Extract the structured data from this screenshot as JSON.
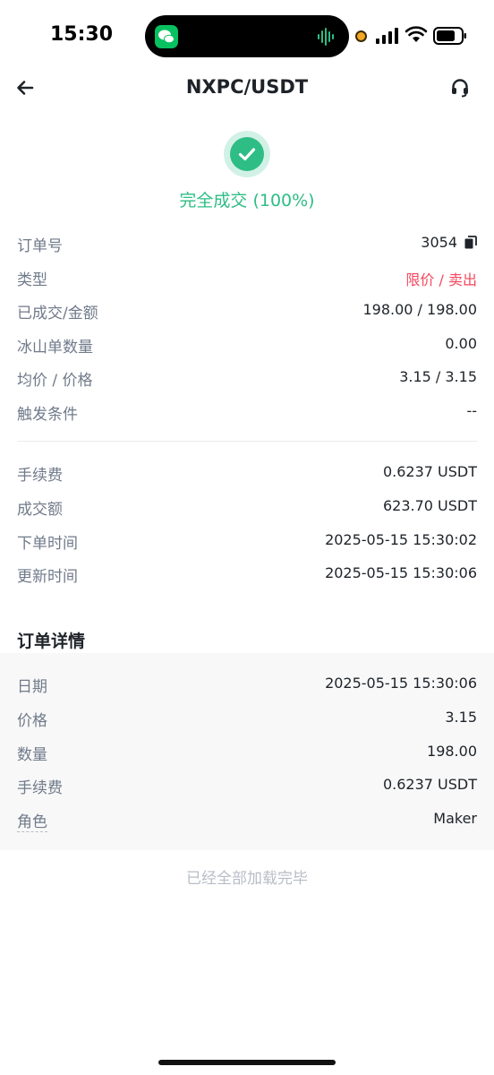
{
  "status_bar": {
    "time": "15:30"
  },
  "header": {
    "title": "NXPC/USDT"
  },
  "order_status": {
    "text": "完全成交 (100%)"
  },
  "order_info": [
    {
      "label": "订单号",
      "value": "3054"
    },
    {
      "label": "类型",
      "value": "限价 / 卖出"
    },
    {
      "label": "已成交/金额",
      "value": "198.00 / 198.00"
    },
    {
      "label": "冰山单数量",
      "value": "0.00"
    },
    {
      "label": "均价 / 价格",
      "value": "3.15 / 3.15"
    },
    {
      "label": "触发条件",
      "value": "--"
    }
  ],
  "fee_info": [
    {
      "label": "手续费",
      "value": "0.6237 USDT"
    },
    {
      "label": "成交额",
      "value": "623.70 USDT"
    },
    {
      "label": "下单时间",
      "value": "2025-05-15 15:30:02"
    },
    {
      "label": "更新时间",
      "value": "2025-05-15 15:30:06"
    }
  ],
  "details": {
    "title": "订单详情",
    "rows": [
      {
        "label": "日期",
        "value": "2025-05-15 15:30:06"
      },
      {
        "label": "价格",
        "value": "3.15"
      },
      {
        "label": "数量",
        "value": "198.00"
      },
      {
        "label": "手续费",
        "value": "0.6237 USDT"
      },
      {
        "label": "角色",
        "value": "Maker"
      }
    ]
  },
  "footer": {
    "text": "已经全部加载完毕"
  },
  "colors": {
    "green": "#2ebd85",
    "red": "#f6465d",
    "label_gray": "#707a8a"
  }
}
